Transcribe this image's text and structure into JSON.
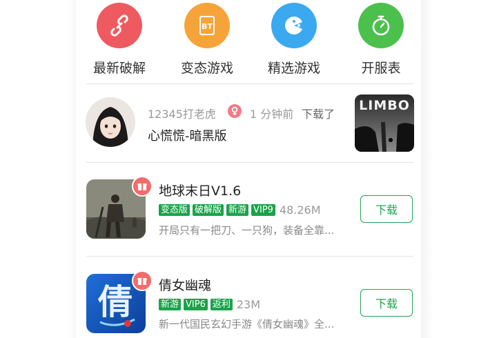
{
  "categories": [
    {
      "label": "最新破解",
      "icon": "link-icon",
      "color": "#ee5a5f"
    },
    {
      "label": "变态游戏",
      "icon": "bt-icon",
      "color": "#f6a43a"
    },
    {
      "label": "精选游戏",
      "icon": "gamepad-icon",
      "color": "#3aa9ef"
    },
    {
      "label": "开服表",
      "icon": "stopwatch-icon",
      "color": "#4bc04c"
    }
  ],
  "activity": {
    "user": "12345打老虎",
    "time": "1 分钟前",
    "verb": "下载了",
    "game": "心慌慌-暗黑版",
    "game_icon_text": "LIMBO"
  },
  "games": [
    {
      "title": "地球末日V1.6",
      "tags": [
        "变态版",
        "破解版",
        "新游",
        "VIP9"
      ],
      "size": "48.26M",
      "desc": "开局只有一把刀、一只狗，装备全靠...",
      "button": "下载"
    },
    {
      "title": "倩女幽魂",
      "tags": [
        "新游",
        "VIP6",
        "返利"
      ],
      "size": "23M",
      "desc": "新一代国民玄幻手游《倩女幽魂》全...",
      "button": "下载",
      "icon_glyph": "倩"
    }
  ],
  "colors": {
    "accent": "#21a24d",
    "tag": "#1aa34a",
    "gift": "#f36b6b"
  }
}
